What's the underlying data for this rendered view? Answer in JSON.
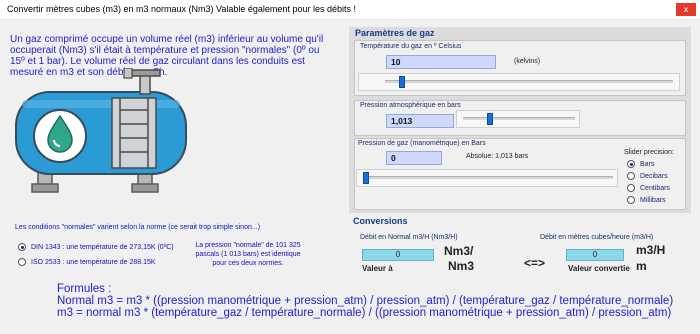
{
  "window": {
    "title": "Convertir mètres cubes (m3) en m3 normaux (Nm3) Valable également pour les débits !",
    "close_label": "x"
  },
  "intro": "Un gaz comprimé occupe un volume réel (m3) inférieur au volume qu'il occuperait (Nm3) s'il était à température et pression \"normales\" (0º ou 15º et 1 bar). Le volume réel de gaz circulant dans les conduits est mesuré en m3 et son débit en m3h.",
  "norms": {
    "note": "Les conditions \"normales\" varient selon la norme (ce serait trop simple sinon...)",
    "options": [
      {
        "label": "DIN 1343 : une température de 273,15K (0ºC)",
        "selected": true
      },
      {
        "label": "ISO 2533 : une température de 288.15K",
        "selected": false
      }
    ],
    "pressure_note": "La pression \"normale\" de 101 325 pascals (1 013 bars) est identique pour ces deux normes."
  },
  "formulas": {
    "title": "Formules :",
    "line1": "Normal m3 = m3 * ((pression manométrique + pression_atm) / pression_atm) / (température_gaz / température_normale)",
    "line2": "m3 = normal m3 * (température_gaz / température_normale) / ((pression manométrique + pression_atm) / pression_atm)"
  },
  "gas_params": {
    "heading": "Paramètres de gaz",
    "temperature": {
      "label": "Température du gaz en º Celsius",
      "value": "10",
      "unit": "(kelvins)",
      "slider_level": 0.05
    },
    "atm_pressure": {
      "label": "Pression atmosphérique en bars",
      "value": "1,013",
      "slider_level": 0.23
    },
    "gauge_pressure": {
      "label": "Pression de gaz (manométrique) en Bars",
      "value": "0",
      "absolute_label": "Absolue: 1,013 bars",
      "slider_level": 0.0
    },
    "precision": {
      "label": "Slider precision:",
      "options": [
        {
          "label": "Bars",
          "selected": true
        },
        {
          "label": "Decibars",
          "selected": false
        },
        {
          "label": "Centibars",
          "selected": false
        },
        {
          "label": "Millibars",
          "selected": false
        }
      ]
    }
  },
  "conversions": {
    "heading": "Conversions",
    "normal": {
      "label": "Débit en Normal m3/H (Nm3/H)",
      "value": "0",
      "unit_line1": "Nm3/",
      "unit_line2": "Nm3",
      "caption": "Valeur à"
    },
    "arrows": "<=>",
    "cubic": {
      "label": "Débit en mètres cubes/heure (m3/H)",
      "value": "0",
      "unit_line1": "m3/H",
      "unit_line2": "m",
      "caption": "Valeur convertie"
    }
  },
  "colors": {
    "accent_blue": "#2020d0",
    "tank": "#2b9bd6",
    "drop": "#2ea88a",
    "close": "#e43a2c"
  }
}
